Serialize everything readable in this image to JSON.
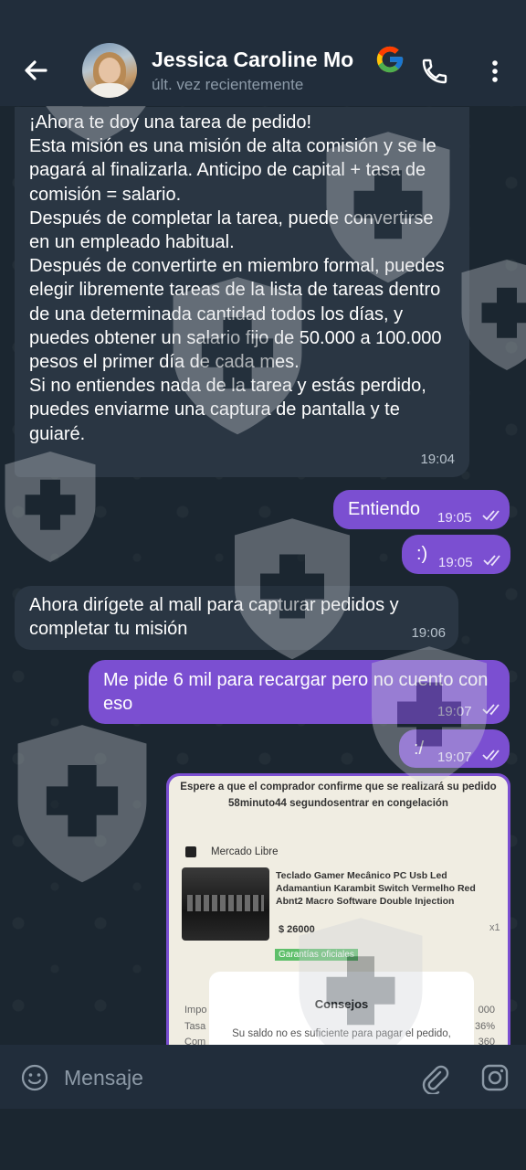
{
  "header": {
    "contact_name": "Jessica Caroline Mo",
    "status": "últ. vez recientemente"
  },
  "messages": [
    {
      "direction": "in",
      "text": "¡Ahora te doy una tarea de pedido!\nEsta misión es una misión de alta comisión y se le pagará al finalizarla. Anticipo de capital + tasa de comisión = salario.\nDespués de completar la tarea, puede convertirse en un empleado habitual.\nDespués de convertirte en miembro formal, puedes elegir libremente tareas de la lista de tareas dentro de una determinada cantidad todos los días, y puedes obtener un salario fijo de 50.000 a 100.000 pesos el primer día de cada mes.\nSi no entiendes nada de la tarea y estás perdido, puedes enviarme una captura de pantalla y te guiaré.",
      "time": "19:04"
    },
    {
      "direction": "out",
      "text": "Entiendo",
      "time": "19:05"
    },
    {
      "direction": "out",
      "text": ":)",
      "time": "19:05"
    },
    {
      "direction": "in",
      "text": "Ahora dirígete al mall para capturar pedidos y completar tu misión",
      "time": "19:06"
    },
    {
      "direction": "out",
      "text": "Me pide 6 mil para recargar pero no cuento con eso",
      "time": "19:07"
    },
    {
      "direction": "out",
      "text": ":/",
      "time": "19:07"
    }
  ],
  "image_message": {
    "top_note": "Espere a que el comprador confirme que se realizará su pedido 58minuto44 segundosentrar en congelación",
    "store": "Mercado Libre",
    "product_title": "Teclado Gamer Mecânico PC Usb Led Adamantiun Karambit Switch Vermelho Red Abnt2 Macro Software Double Injection",
    "price": "$ 26000",
    "quantity": "x1",
    "badge": "Garantías oficiales",
    "row1_left": "Impo",
    "row1_right": "000",
    "row2_left": "Tasa",
    "row2_right": "36%",
    "row3_left": "Com",
    "row3_right": "360",
    "dialog_title": "Consejos",
    "dialog_text": "Su saldo no es suficiente para pagar el pedido,"
  },
  "input": {
    "placeholder": "Mensaje"
  },
  "colors": {
    "background": "#1b2630",
    "header": "#212d3b",
    "incoming_bubble": "#2a3643",
    "outgoing_bubble": "#7b4fd1"
  },
  "icons": [
    "back-arrow-icon",
    "google-icon",
    "phone-icon",
    "more-vertical-icon",
    "emoji-icon",
    "paperclip-icon",
    "instagram-icon",
    "shield-watermark-icon",
    "double-check-icon"
  ]
}
